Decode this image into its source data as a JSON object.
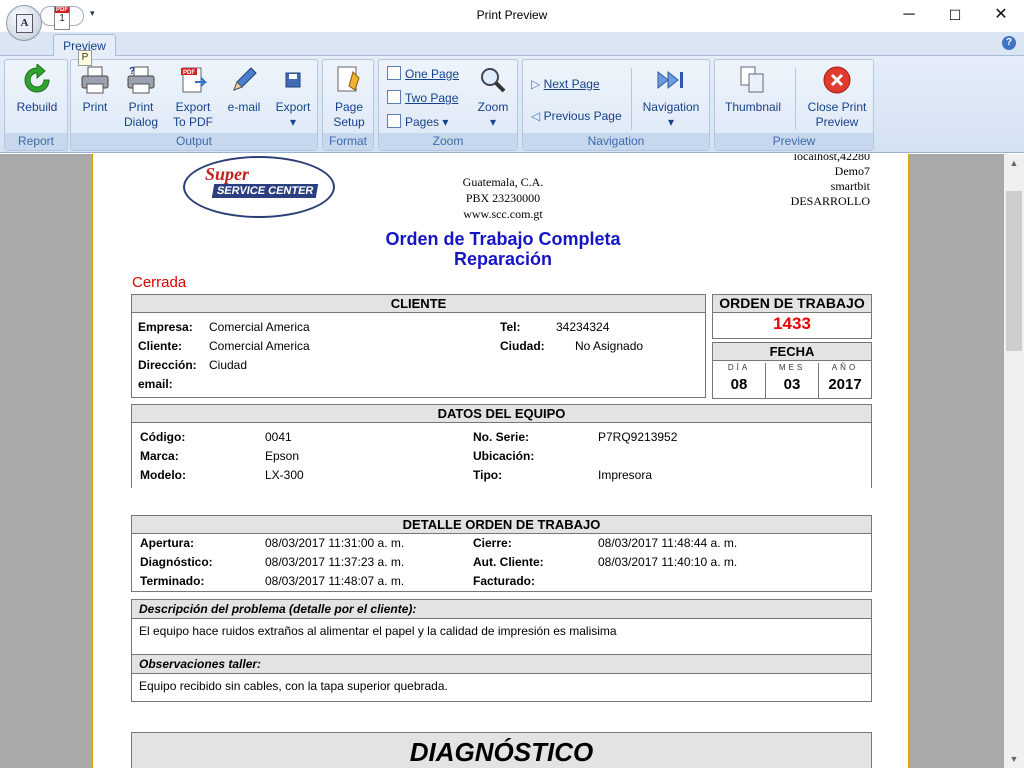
{
  "window": {
    "title": "Print Preview",
    "minimize": "─",
    "maximize": "☐",
    "close": "✕"
  },
  "qat": {
    "pdf_label": "PDF",
    "page_num": "1",
    "dropdown": "▾"
  },
  "app_button": {
    "glyph": "A"
  },
  "ribbon": {
    "tab": "Preview",
    "keytip": "P",
    "groups": {
      "report": {
        "label": "Report",
        "rebuild": "Rebuild"
      },
      "output": {
        "label": "Output",
        "print": "Print",
        "print_dialog": [
          "Print",
          "Dialog"
        ],
        "export_pdf": [
          "Export",
          "To PDF"
        ],
        "email": "e-mail",
        "export": "Export"
      },
      "format": {
        "label": "Format",
        "page_setup": [
          "Page",
          "Setup"
        ]
      },
      "zoom": {
        "label": "Zoom",
        "one_page": "One Page",
        "two_page": "Two Page",
        "pages": "Pages",
        "zoom": "Zoom"
      },
      "navigation": {
        "label": "Navigation",
        "next_page": "Next Page",
        "previous_page": "Previous Page",
        "navigation": "Navigation"
      },
      "preview": {
        "label": "Preview",
        "thumbnail": "Thumbnail",
        "close": [
          "Close Print",
          "Preview"
        ]
      }
    }
  },
  "report": {
    "logo": {
      "line1": "Super",
      "line2": "SERVICE CENTER"
    },
    "company": [
      "Guatemala, C.A.",
      "PBX 23230000",
      "www.scc.com.gt"
    ],
    "meta": [
      "localhost,42280",
      "Demo7",
      "smartbit",
      "DESARROLLO"
    ],
    "title": "Orden de Trabajo Completa",
    "subtitle": "Reparación",
    "status": "Cerrada",
    "cliente": {
      "header": "CLIENTE",
      "empresa_k": "Empresa:",
      "empresa_v": "Comercial America",
      "cliente_k": "Cliente:",
      "cliente_v": "Comercial America",
      "direccion_k": "Dirección:",
      "direccion_v": "Ciudad",
      "email_k": "email:",
      "tel_k": "Tel:",
      "tel_v": "34234324",
      "ciudad_k": "Ciudad:",
      "ciudad_v": "No Asignado"
    },
    "orden": {
      "header": "ORDEN DE TRABAJO",
      "number": "1433"
    },
    "fecha": {
      "header": "FECHA",
      "dia_l": "DÍA",
      "mes_l": "MES",
      "anio_l": "AÑO",
      "dia": "08",
      "mes": "03",
      "anio": "2017"
    },
    "equipo": {
      "header": "DATOS DEL EQUIPO",
      "codigo_k": "Código:",
      "codigo_v": "0041",
      "marca_k": "Marca:",
      "marca_v": "Epson",
      "modelo_k": "Modelo:",
      "modelo_v": "LX-300",
      "serie_k": "No. Serie:",
      "serie_v": "P7RQ9213952",
      "ubic_k": "Ubicación:",
      "tipo_k": "Tipo:",
      "tipo_v": "Impresora"
    },
    "detalle": {
      "header": "DETALLE ORDEN DE TRABAJO",
      "apertura_k": "Apertura:",
      "apertura_v": "08/03/2017 11:31:00 a. m.",
      "diag_k": "Diagnóstico:",
      "diag_v": "08/03/2017 11:37:23 a. m.",
      "term_k": "Terminado:",
      "term_v": "08/03/2017 11:48:07 a. m.",
      "cierre_k": "Cierre:",
      "cierre_v": "08/03/2017 11:48:44 a. m.",
      "aut_k": "Aut. Cliente:",
      "aut_v": "08/03/2017 11:40:10 a. m.",
      "fact_k": "Facturado:"
    },
    "problema": {
      "header": "Descripción del problema (detalle por el cliente):",
      "text": "El equipo hace ruidos extraños al alimentar el papel y la calidad de impresión es malisima"
    },
    "observ": {
      "header": "Observaciones taller:",
      "text": "Equipo recibido sin cables, con la tapa superior quebrada."
    },
    "diagnostico": "DIAGNÓSTICO"
  }
}
